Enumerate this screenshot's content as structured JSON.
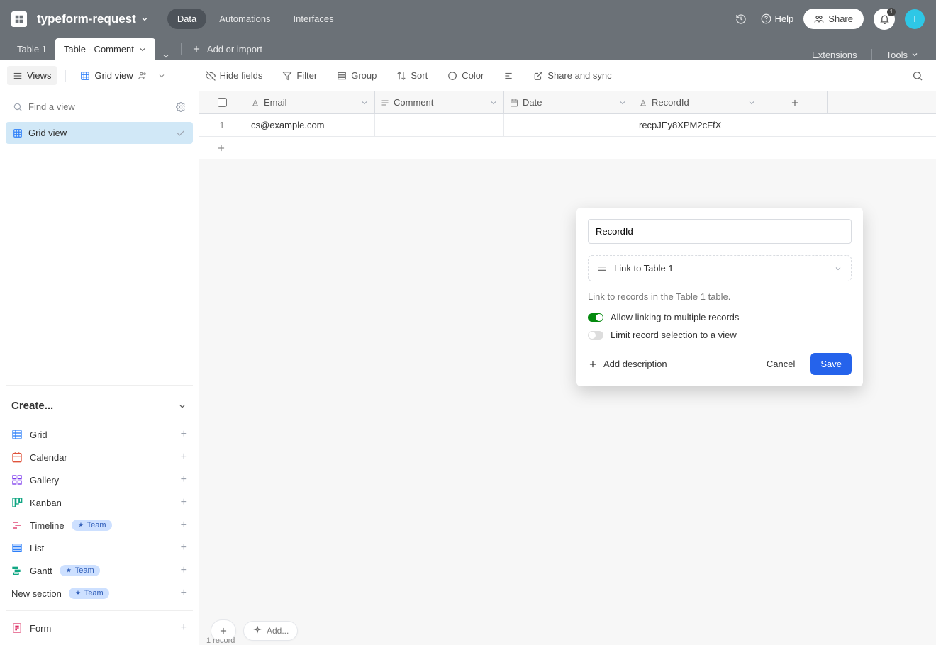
{
  "header": {
    "base_name": "typeform-request",
    "nav": {
      "data": "Data",
      "automations": "Automations",
      "interfaces": "Interfaces"
    },
    "help": "Help",
    "share": "Share",
    "notification_count": "1",
    "avatar_initial": "I"
  },
  "tabs": {
    "table1": "Table 1",
    "table_comment": "Table - Comment",
    "add_or_import": "Add or import",
    "extensions": "Extensions",
    "tools": "Tools"
  },
  "toolbar": {
    "views": "Views",
    "grid_view": "Grid view",
    "hide_fields": "Hide fields",
    "filter": "Filter",
    "group": "Group",
    "sort": "Sort",
    "color": "Color",
    "share_sync": "Share and sync"
  },
  "sidebar": {
    "search_placeholder": "Find a view",
    "active_view": "Grid view",
    "create_label": "Create...",
    "create_items": {
      "grid": "Grid",
      "calendar": "Calendar",
      "gallery": "Gallery",
      "kanban": "Kanban",
      "timeline": "Timeline",
      "list": "List",
      "gantt": "Gantt",
      "new_section": "New section",
      "form": "Form"
    },
    "team_badge": "Team"
  },
  "columns": {
    "email": "Email",
    "comment": "Comment",
    "date": "Date",
    "recordid": "RecordId"
  },
  "rows": [
    {
      "num": "1",
      "email": "cs@example.com",
      "comment": "",
      "date": "",
      "recordid": "recpJEy8XPM2cFfX"
    }
  ],
  "footer": {
    "add_label": "Add...",
    "record_count": "1 record"
  },
  "popup": {
    "field_name": "RecordId",
    "type_label": "Link to Table 1",
    "helper": "Link to records in the Table 1 table.",
    "allow_multi": "Allow linking to multiple records",
    "limit_view": "Limit record selection to a view",
    "add_description": "Add description",
    "cancel": "Cancel",
    "save": "Save"
  }
}
